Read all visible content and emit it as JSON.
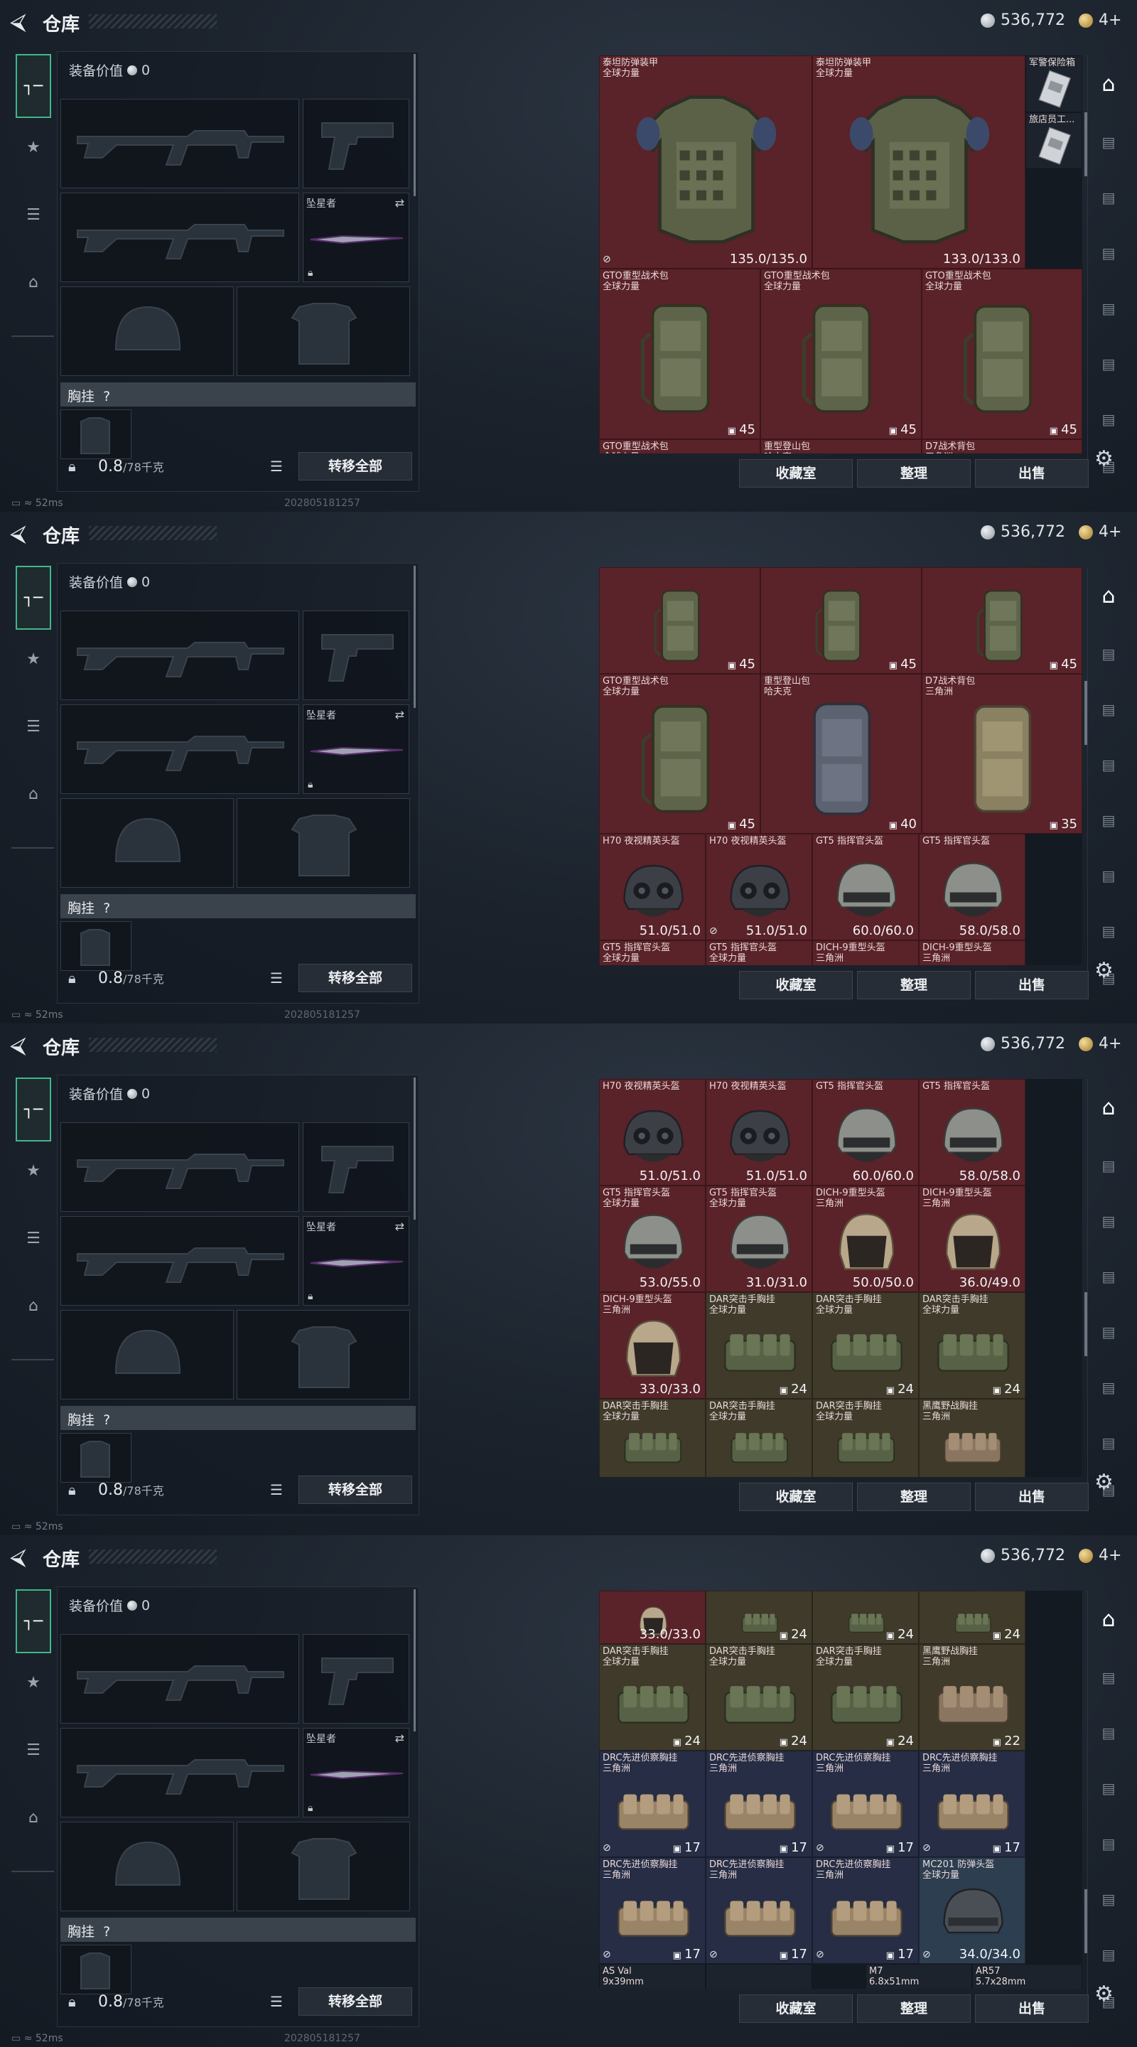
{
  "header": {
    "back_icon": "back-arrow-icon",
    "title": "仓库",
    "silver": "536,772",
    "gold": "4+"
  },
  "left_tabs": [
    {
      "icon": "gun-icon"
    },
    {
      "icon": "badge-icon"
    },
    {
      "icon": "clipboard-icon"
    },
    {
      "icon": "briefcase-icon"
    }
  ],
  "equipment": {
    "value_label": "装备价值",
    "value": "0",
    "melee_label": "坠星者",
    "chest_label": "胸挂",
    "chest_help": "?",
    "weight": "0.8",
    "weight_max": "/78千克",
    "transfer_all": "转移全部"
  },
  "actions": {
    "collection": "收藏室",
    "sort": "整理",
    "sell": "出售"
  },
  "status": {
    "ping": "52ms",
    "build": "20280518125?"
  },
  "status_frames": [
    {
      "ping": "52ms",
      "build": "202805181257"
    },
    {
      "ping": "52ms",
      "build": "202805181257"
    },
    {
      "ping": "52ms",
      "build": ""
    },
    {
      "ping": "52ms",
      "build": "202805181257"
    }
  ],
  "frames": [
    {
      "cells": [
        {
          "name": "泰坦防弹装甲",
          "sub": "全球力量",
          "value": "135.0/135.0",
          "color": "red",
          "art": "armor",
          "badge_l": "broken-icon"
        },
        {
          "name": "泰坦防弹装甲",
          "sub": "全球力量",
          "value": "133.0/133.0",
          "color": "red",
          "art": "armor"
        },
        {
          "name": "军警保险箱",
          "sub": "",
          "value": "",
          "color": "dark",
          "art": "case"
        },
        {
          "name": "旅店员工...",
          "sub": "",
          "value": "",
          "color": "dark",
          "art": "case"
        },
        {
          "name": "GTO重型战术包",
          "sub": "全球力量",
          "value": "45",
          "color": "red",
          "art": "bag"
        },
        {
          "name": "GTO重型战术包",
          "sub": "全球力量",
          "value": "45",
          "color": "red",
          "art": "bag"
        },
        {
          "name": "GTO重型战术包",
          "sub": "全球力量",
          "value": "45",
          "color": "red",
          "art": "bag"
        },
        {
          "name": "GTO重型战术包",
          "sub": "全球力量",
          "value": "",
          "color": "red",
          "art": ""
        },
        {
          "name": "重型登山包",
          "sub": "哈夫克",
          "value": "",
          "color": "red",
          "art": ""
        },
        {
          "name": "D7战术背包",
          "sub": "三角洲",
          "value": "",
          "color": "red",
          "art": ""
        }
      ]
    },
    {
      "cells": [
        {
          "name": "",
          "sub": "",
          "value": "45",
          "color": "red",
          "art": "bag"
        },
        {
          "name": "",
          "sub": "",
          "value": "45",
          "color": "red",
          "art": "bag"
        },
        {
          "name": "",
          "sub": "",
          "value": "45",
          "color": "red",
          "art": "bag"
        },
        {
          "name": "GTO重型战术包",
          "sub": "全球力量",
          "value": "45",
          "color": "red",
          "art": "bag"
        },
        {
          "name": "重型登山包",
          "sub": "哈夫克",
          "value": "40",
          "color": "red",
          "art": "bag-grey"
        },
        {
          "name": "D7战术背包",
          "sub": "三角洲",
          "value": "35",
          "color": "red",
          "art": "bag-tan"
        },
        {
          "name": "H70 夜视精英头盔",
          "sub": "",
          "value": "51.0/51.0",
          "color": "red",
          "art": "helmet-nv"
        },
        {
          "name": "H70 夜视精英头盔",
          "sub": "",
          "value": "51.0/51.0",
          "color": "red",
          "art": "helmet-nv",
          "badge_l": "broken-icon"
        },
        {
          "name": "GT5 指挥官头盔",
          "sub": "",
          "value": "60.0/60.0",
          "color": "red",
          "art": "helmet"
        },
        {
          "name": "GT5 指挥官头盔",
          "sub": "",
          "value": "58.0/58.0",
          "color": "red",
          "art": "helmet"
        },
        {
          "name": "GT5 指挥官头盔",
          "sub": "全球力量",
          "value": "",
          "color": "red",
          "art": ""
        },
        {
          "name": "GT5 指挥官头盔",
          "sub": "全球力量",
          "value": "",
          "color": "red",
          "art": ""
        },
        {
          "name": "DICH-9重型头盔",
          "sub": "三角洲",
          "value": "",
          "color": "red",
          "art": ""
        },
        {
          "name": "DICH-9重型头盔",
          "sub": "三角洲",
          "value": "",
          "color": "red",
          "art": ""
        }
      ]
    },
    {
      "cells": [
        {
          "name": "H70 夜视精英头盔",
          "sub": "",
          "value": "51.0/51.0",
          "color": "red",
          "art": "helmet-nv"
        },
        {
          "name": "H70 夜视精英头盔",
          "sub": "",
          "value": "51.0/51.0",
          "color": "red",
          "art": "helmet-nv"
        },
        {
          "name": "GT5 指挥官头盔",
          "sub": "",
          "value": "60.0/60.0",
          "color": "red",
          "art": "helmet"
        },
        {
          "name": "GT5 指挥官头盔",
          "sub": "",
          "value": "58.0/58.0",
          "color": "red",
          "art": "helmet"
        },
        {
          "name": "GT5 指挥官头盔",
          "sub": "全球力量",
          "value": "53.0/55.0",
          "color": "red",
          "art": "helmet"
        },
        {
          "name": "GT5 指挥官头盔",
          "sub": "全球力量",
          "value": "31.0/31.0",
          "color": "red",
          "art": "helmet"
        },
        {
          "name": "DICH-9重型头盔",
          "sub": "三角洲",
          "value": "50.0/50.0",
          "color": "red",
          "art": "helmet-tan"
        },
        {
          "name": "DICH-9重型头盔",
          "sub": "三角洲",
          "value": "36.0/49.0",
          "color": "red",
          "art": "helmet-tan"
        },
        {
          "name": "DICH-9重型头盔",
          "sub": "三角洲",
          "value": "33.0/33.0",
          "color": "red",
          "art": "helmet-tan"
        },
        {
          "name": "DAR突击手胸挂",
          "sub": "全球力量",
          "value": "24",
          "color": "olive",
          "art": "rig"
        },
        {
          "name": "DAR突击手胸挂",
          "sub": "全球力量",
          "value": "24",
          "color": "olive",
          "art": "rig"
        },
        {
          "name": "DAR突击手胸挂",
          "sub": "全球力量",
          "value": "24",
          "color": "olive",
          "art": "rig"
        },
        {
          "name": "DAR突击手胸挂",
          "sub": "全球力量",
          "value": "",
          "color": "olive",
          "art": "rig"
        },
        {
          "name": "DAR突击手胸挂",
          "sub": "全球力量",
          "value": "",
          "color": "olive",
          "art": "rig"
        },
        {
          "name": "DAR突击手胸挂",
          "sub": "全球力量",
          "value": "",
          "color": "olive",
          "art": "rig"
        },
        {
          "name": "黑鹰野战胸挂",
          "sub": "三角洲",
          "value": "",
          "color": "olive",
          "art": "rig-tan"
        }
      ]
    },
    {
      "cells": [
        {
          "name": "",
          "sub": "",
          "value": "33.0/33.0",
          "color": "red",
          "art": "helmet-tan"
        },
        {
          "name": "",
          "sub": "",
          "value": "24",
          "color": "olive",
          "art": "rig"
        },
        {
          "name": "",
          "sub": "",
          "value": "24",
          "color": "olive",
          "art": "rig"
        },
        {
          "name": "",
          "sub": "",
          "value": "24",
          "color": "olive",
          "art": "rig"
        },
        {
          "name": "DAR突击手胸挂",
          "sub": "全球力量",
          "value": "24",
          "color": "olive",
          "art": "rig"
        },
        {
          "name": "DAR突击手胸挂",
          "sub": "全球力量",
          "value": "24",
          "color": "olive",
          "art": "rig"
        },
        {
          "name": "DAR突击手胸挂",
          "sub": "全球力量",
          "value": "24",
          "color": "olive",
          "art": "rig"
        },
        {
          "name": "黑鹰野战胸挂",
          "sub": "三角洲",
          "value": "22",
          "color": "olive",
          "art": "rig-tan"
        },
        {
          "name": "DRC先进侦察胸挂",
          "sub": "三角洲",
          "value": "17",
          "color": "navy",
          "art": "rig-sand",
          "badge_l": "broken-icon"
        },
        {
          "name": "DRC先进侦察胸挂",
          "sub": "三角洲",
          "value": "17",
          "color": "navy",
          "art": "rig-sand"
        },
        {
          "name": "DRC先进侦察胸挂",
          "sub": "三角洲",
          "value": "17",
          "color": "navy",
          "art": "rig-sand",
          "badge_l": "broken-icon"
        },
        {
          "name": "DRC先进侦察胸挂",
          "sub": "三角洲",
          "value": "17",
          "color": "navy",
          "art": "rig-sand",
          "badge_l": "broken-icon"
        },
        {
          "name": "DRC先进侦察胸挂",
          "sub": "三角洲",
          "value": "17",
          "color": "navy",
          "art": "rig-sand",
          "badge_l": "broken-icon"
        },
        {
          "name": "DRC先进侦察胸挂",
          "sub": "三角洲",
          "value": "17",
          "color": "navy",
          "art": "rig-sand",
          "badge_l": "broken-icon"
        },
        {
          "name": "DRC先进侦察胸挂",
          "sub": "三角洲",
          "value": "17",
          "color": "navy",
          "art": "rig-sand",
          "badge_l": "broken-icon"
        },
        {
          "name": "MC201 防弹头盔",
          "sub": "全球力量",
          "value": "34.0/34.0",
          "color": "teal",
          "art": "helmet-dark",
          "badge_l": "broken-icon"
        },
        {
          "name": "AS Val",
          "sub": "9x39mm",
          "value": "",
          "color": "dark",
          "art": ""
        },
        {
          "name": "",
          "sub": "",
          "value": "",
          "color": "dark",
          "art": ""
        },
        {
          "name": "M7",
          "sub": "6.8x51mm",
          "value": "",
          "color": "dark",
          "art": ""
        },
        {
          "name": "AR57",
          "sub": "5.7x28mm",
          "value": "",
          "color": "dark",
          "art": ""
        }
      ]
    }
  ]
}
